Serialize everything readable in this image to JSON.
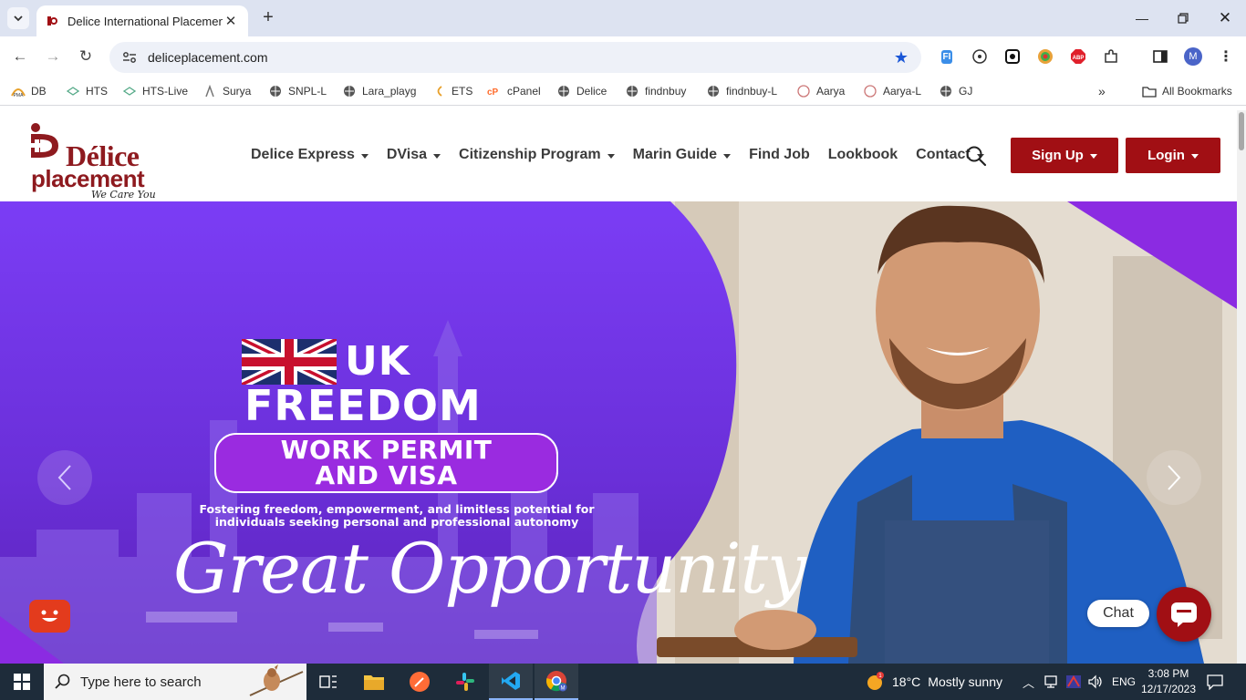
{
  "browser": {
    "tab_title": "Delice International Placement",
    "url": "deliceplacement.com",
    "profile_initial": "M",
    "bookmarks": [
      {
        "label": "DB",
        "icon": "pma-icon"
      },
      {
        "label": "HTS",
        "icon": "hts-icon"
      },
      {
        "label": "HTS-Live",
        "icon": "hts-icon"
      },
      {
        "label": "Surya",
        "icon": "surya-icon"
      },
      {
        "label": "SNPL-L",
        "icon": "globe-icon"
      },
      {
        "label": "Lara_playg",
        "icon": "globe-icon"
      },
      {
        "label": "ETS",
        "icon": "ets-icon"
      },
      {
        "label": "cPanel",
        "icon": "cpanel-icon"
      },
      {
        "label": "Delice",
        "icon": "globe-icon"
      },
      {
        "label": "findnbuy",
        "icon": "globe-icon"
      },
      {
        "label": "findnbuy-L",
        "icon": "globe-icon"
      },
      {
        "label": "Aarya",
        "icon": "aarya-icon"
      },
      {
        "label": "Aarya-L",
        "icon": "aarya-icon"
      },
      {
        "label": "GJ",
        "icon": "globe-icon"
      }
    ],
    "all_bookmarks_label": "All Bookmarks"
  },
  "site": {
    "logo": {
      "line1": "Délice",
      "line2": "placement",
      "tagline": "We Care You"
    },
    "nav": [
      {
        "label": "Delice Express",
        "dropdown": true
      },
      {
        "label": "DVisa",
        "dropdown": true
      },
      {
        "label": "Citizenship Program",
        "dropdown": true
      },
      {
        "label": "Marin Guide",
        "dropdown": true
      },
      {
        "label": "Find Job",
        "dropdown": false
      },
      {
        "label": "Lookbook",
        "dropdown": false
      },
      {
        "label": "Contact",
        "dropdown": true
      }
    ],
    "signup_label": "Sign Up",
    "login_label": "Login",
    "brand_color": "#a10f14"
  },
  "hero": {
    "country": "UK",
    "headline": "FREEDOM",
    "pill_line1": "WORK PERMIT",
    "pill_line2": "AND VISA",
    "description_line1": "Fostering freedom, empowerment, and limitless potential for",
    "description_line2": "individuals seeking personal and professional autonomy",
    "script": "Great Opportunity",
    "accent_color": "#7b2ff7"
  },
  "chat": {
    "label": "Chat"
  },
  "taskbar": {
    "search_placeholder": "Type here to search",
    "weather_temp": "18°C",
    "weather_text": "Mostly sunny",
    "language": "ENG",
    "time": "3:08 PM",
    "date": "12/17/2023"
  }
}
